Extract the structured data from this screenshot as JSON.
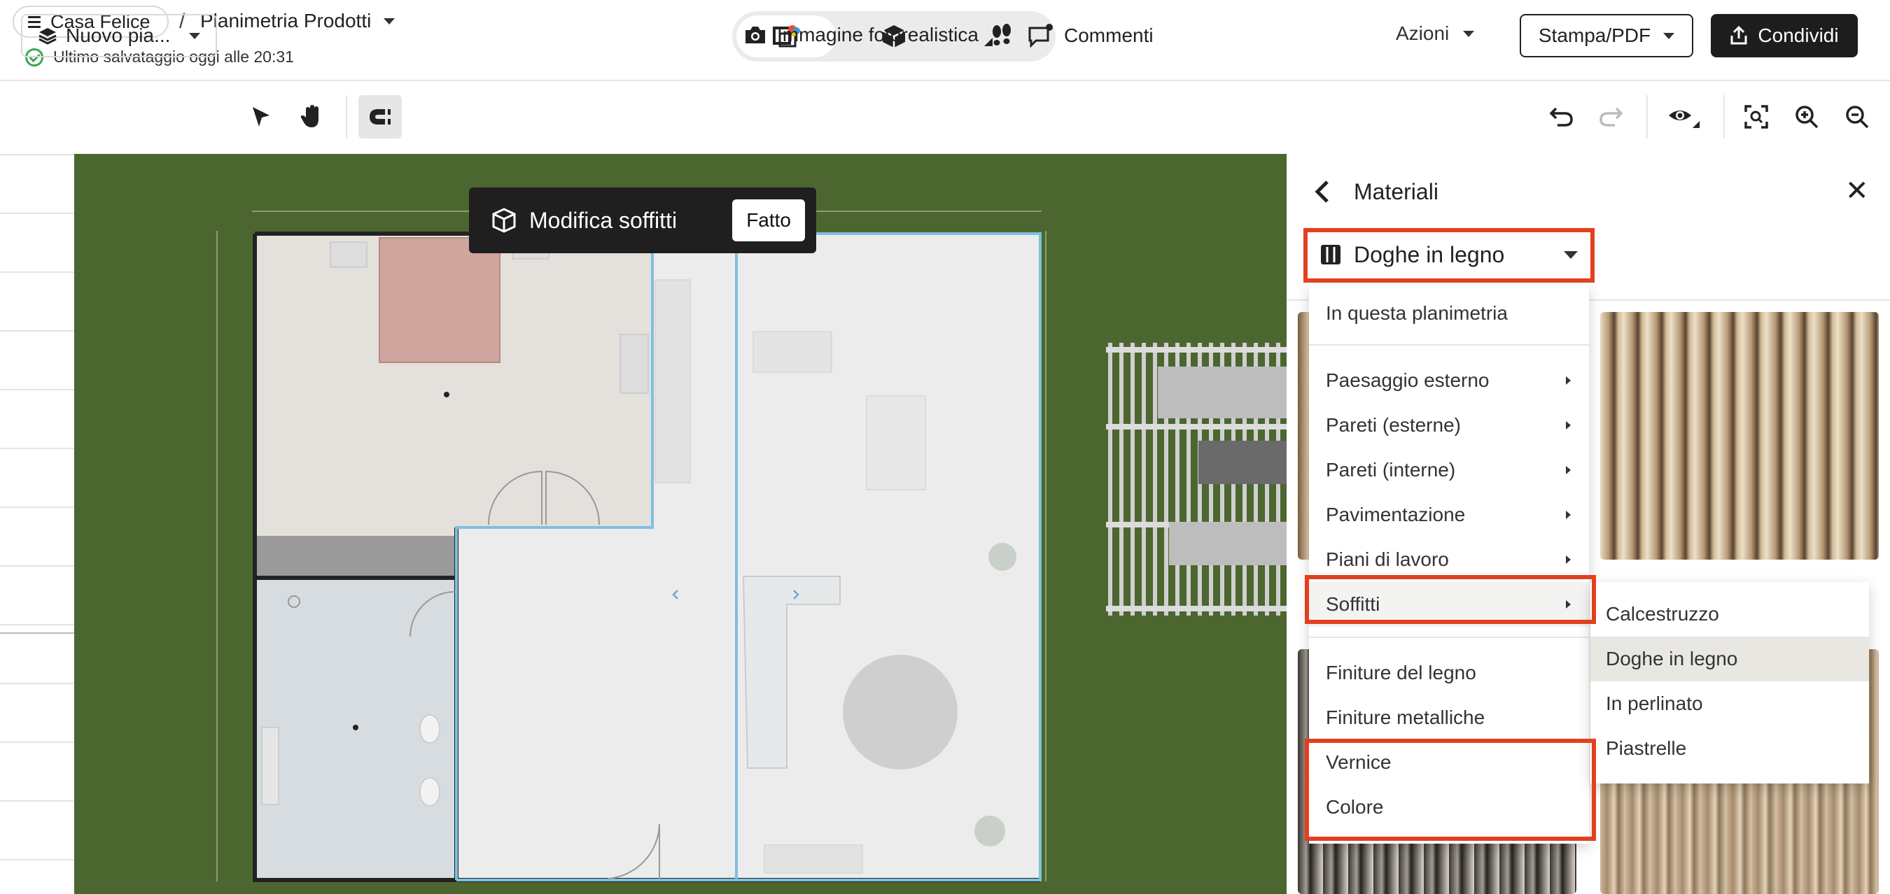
{
  "header": {
    "project_name": "Casa Felice",
    "breadcrumb_separator": "/",
    "plan_name": "Planimetria Prodotti",
    "save_status": "Ultimo salvataggio oggi alle 20:31",
    "view_modes": [
      "2d-plan-icon",
      "3d-box-icon",
      "walkthrough-footsteps-icon"
    ],
    "actions_label": "Azioni",
    "print_label": "Stampa/PDF",
    "share_label": "Condividi"
  },
  "toolbar": {
    "floor_label": "Nuovo pia...",
    "photoreal_label": "Immagine fotorealistica",
    "comments_label": "Commenti"
  },
  "editbar": {
    "title": "Modifica soffitti",
    "done_label": "Fatto"
  },
  "panel": {
    "title": "Materiali",
    "selected_category": "Doghe in legno",
    "menu": {
      "in_plan": "In questa planimetria",
      "items": [
        "Paesaggio esterno",
        "Pareti (esterne)",
        "Pareti (interne)",
        "Pavimentazione",
        "Piani di lavoro",
        "Soffitti",
        "Finiture del legno",
        "Finiture metalliche",
        "Vernice",
        "Colore"
      ]
    },
    "submenu": [
      "Calcestruzzo",
      "Doghe in legno",
      "In perlinato",
      "Piastrelle"
    ],
    "submenu_selected": "Doghe in legno"
  },
  "colors": {
    "accent_highlight": "#e2401f",
    "grass": "#4c6630",
    "save_ok": "#3aa655",
    "dark_button": "#1d1d1d"
  }
}
